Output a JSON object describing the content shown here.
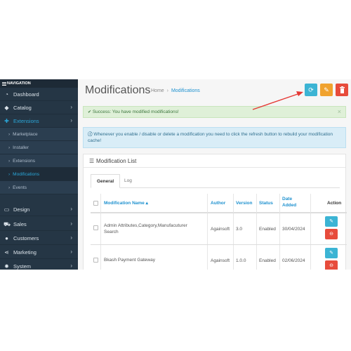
{
  "sidebar": {
    "header": "NAVIGATION",
    "items": [
      {
        "label": "Dashboard",
        "icon": "dashboard-icon"
      },
      {
        "label": "Catalog",
        "icon": "tags-icon",
        "chevron": "›"
      },
      {
        "label": "Extensions",
        "icon": "puzzle-icon",
        "chevron": "›"
      },
      {
        "label": "Marketplace"
      },
      {
        "label": "Installer"
      },
      {
        "label": "Extensions"
      },
      {
        "label": "Modifications"
      },
      {
        "label": "Events"
      },
      {
        "label": "Design",
        "icon": "monitor-icon",
        "chevron": "›"
      },
      {
        "label": "Sales",
        "icon": "cart-icon",
        "chevron": "›"
      },
      {
        "label": "Customers",
        "icon": "user-icon",
        "chevron": "›"
      },
      {
        "label": "Marketing",
        "icon": "share-icon",
        "chevron": "›"
      },
      {
        "label": "System",
        "icon": "gear-icon",
        "chevron": "›"
      }
    ]
  },
  "header": {
    "title": "Modifications",
    "breadcrumb": {
      "home": "Home",
      "separator": "›",
      "current": "Modifications"
    }
  },
  "toolbar": {
    "refresh_icon": "⟳",
    "clear_icon": "✎",
    "delete_icon": "🗑"
  },
  "alerts": {
    "success": "Success: You have modified modifications!",
    "success_close": "×",
    "info": "Whenever you enable / disable or delete a modification you need to click the refresh button to rebuild your modification cache!"
  },
  "panel": {
    "title": "Modification List",
    "tabs": [
      {
        "label": "General"
      },
      {
        "label": "Log"
      }
    ]
  },
  "table": {
    "columns": {
      "name": "Modification Name",
      "sort_indicator": "▴",
      "author": "Author",
      "version": "Version",
      "status": "Status",
      "date_added_line1": "Date",
      "date_added_line2": "Added",
      "action": "Action"
    },
    "rows": [
      {
        "name_line1": "Admin Attributes,Category,Manufacuturer",
        "name_line2": "Search",
        "author": "Againsoft",
        "version": "3.0",
        "status": "Enabled",
        "date_added": "30/04/2024"
      },
      {
        "name_line1": "Bkash Payment Gateway",
        "name_line2": "",
        "author": "Againsoft",
        "version": "1.0.0",
        "status": "Enabled",
        "date_added": "02/06/2024"
      }
    ]
  },
  "colors": {
    "sidebar_bg": "#253645",
    "accent_blue": "#1e91cf",
    "btn_info": "#3cb4d4",
    "btn_warning": "#f0a22e",
    "btn_danger": "#e74c3c",
    "annotation_arrow": "#e53935"
  }
}
